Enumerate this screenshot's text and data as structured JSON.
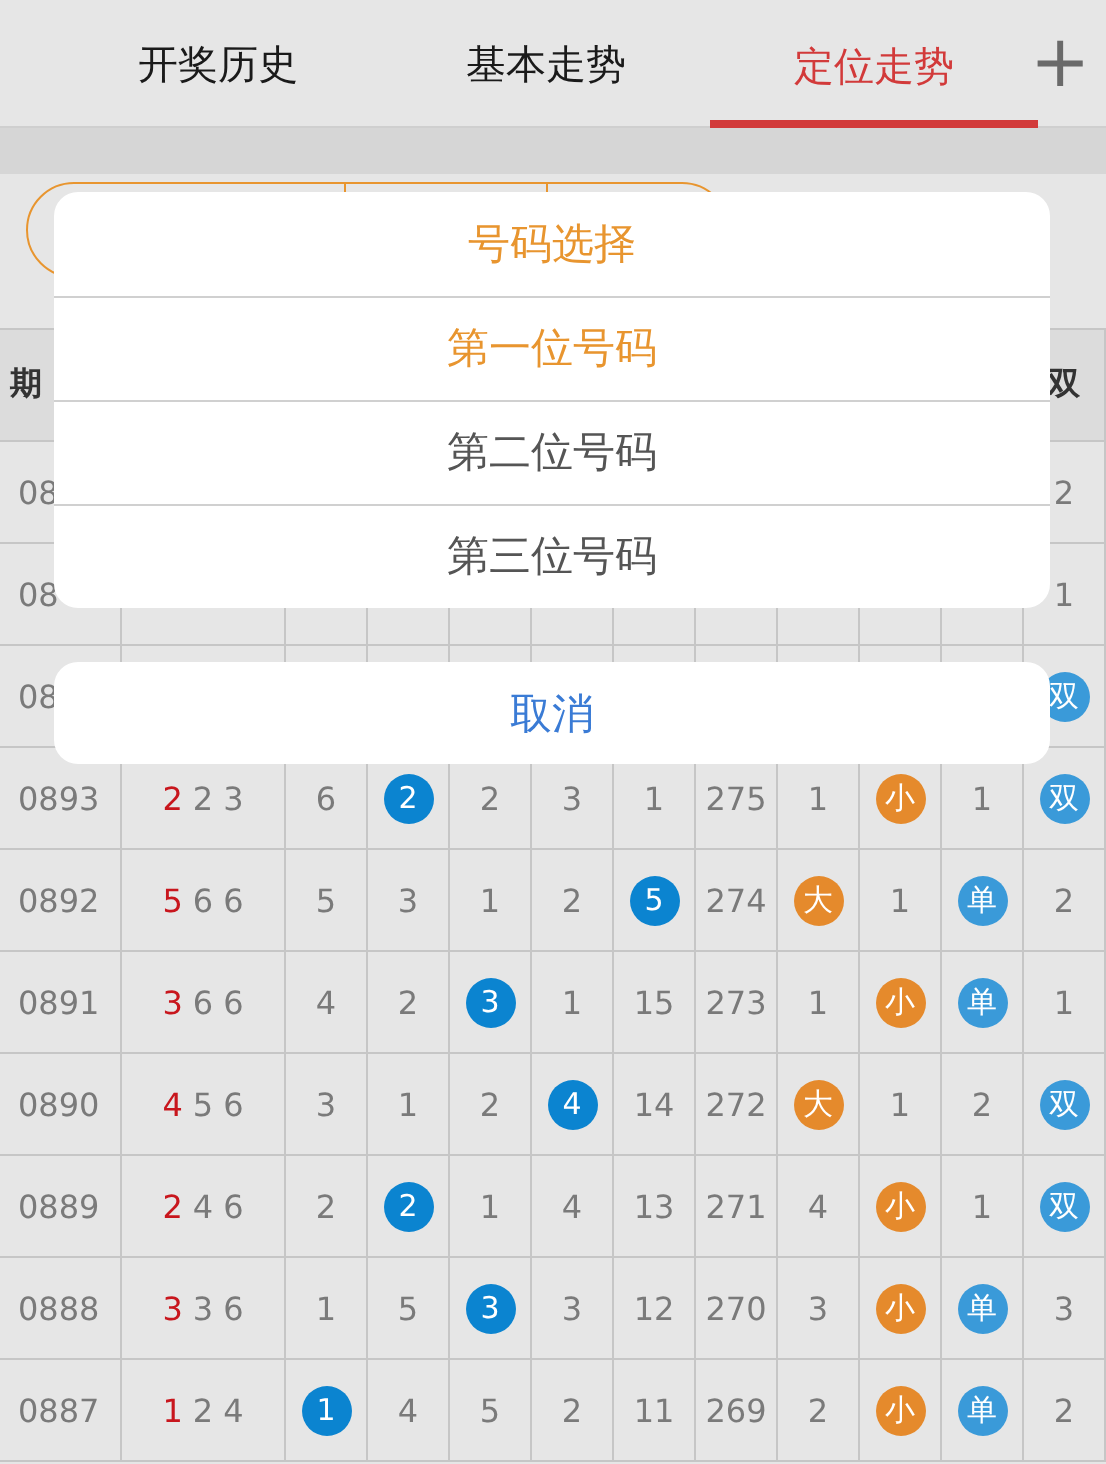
{
  "tabs": [
    {
      "label": "开奖历史",
      "selected": false
    },
    {
      "label": "基本走势",
      "selected": false
    },
    {
      "label": "定位走势",
      "selected": true
    }
  ],
  "add_button": {
    "label": "+"
  },
  "table": {
    "header": {
      "first": "期",
      "last": "双"
    },
    "hidden_rows": [
      {
        "issue": "08",
        "last": {
          "text": "2",
          "kind": "plain"
        }
      },
      {
        "issue": "08",
        "last": {
          "text": "1",
          "kind": "plain"
        }
      },
      {
        "issue": "08",
        "last": {
          "text": "双",
          "kind": "parity"
        }
      }
    ],
    "rows": [
      {
        "issue": "0893",
        "draw": [
          "2",
          "2",
          "3"
        ],
        "cells": [
          {
            "text": "6",
            "kind": "plain"
          },
          {
            "text": "2",
            "kind": "ball"
          },
          {
            "text": "2",
            "kind": "plain"
          },
          {
            "text": "3",
            "kind": "plain"
          },
          {
            "text": "1",
            "kind": "plain"
          },
          {
            "text": "275",
            "kind": "plain"
          },
          {
            "text": "1",
            "kind": "plain"
          },
          {
            "text": "小",
            "kind": "size"
          },
          {
            "text": "1",
            "kind": "plain"
          },
          {
            "text": "双",
            "kind": "parity"
          }
        ]
      },
      {
        "issue": "0892",
        "draw": [
          "5",
          "6",
          "6"
        ],
        "cells": [
          {
            "text": "5",
            "kind": "plain"
          },
          {
            "text": "3",
            "kind": "plain"
          },
          {
            "text": "1",
            "kind": "plain"
          },
          {
            "text": "2",
            "kind": "plain"
          },
          {
            "text": "5",
            "kind": "ball"
          },
          {
            "text": "274",
            "kind": "plain"
          },
          {
            "text": "大",
            "kind": "size"
          },
          {
            "text": "1",
            "kind": "plain"
          },
          {
            "text": "单",
            "kind": "parity"
          },
          {
            "text": "2",
            "kind": "plain"
          }
        ]
      },
      {
        "issue": "0891",
        "draw": [
          "3",
          "6",
          "6"
        ],
        "cells": [
          {
            "text": "4",
            "kind": "plain"
          },
          {
            "text": "2",
            "kind": "plain"
          },
          {
            "text": "3",
            "kind": "ball"
          },
          {
            "text": "1",
            "kind": "plain"
          },
          {
            "text": "15",
            "kind": "plain"
          },
          {
            "text": "273",
            "kind": "plain"
          },
          {
            "text": "1",
            "kind": "plain"
          },
          {
            "text": "小",
            "kind": "size"
          },
          {
            "text": "单",
            "kind": "parity"
          },
          {
            "text": "1",
            "kind": "plain"
          }
        ]
      },
      {
        "issue": "0890",
        "draw": [
          "4",
          "5",
          "6"
        ],
        "cells": [
          {
            "text": "3",
            "kind": "plain"
          },
          {
            "text": "1",
            "kind": "plain"
          },
          {
            "text": "2",
            "kind": "plain"
          },
          {
            "text": "4",
            "kind": "ball"
          },
          {
            "text": "14",
            "kind": "plain"
          },
          {
            "text": "272",
            "kind": "plain"
          },
          {
            "text": "大",
            "kind": "size"
          },
          {
            "text": "1",
            "kind": "plain"
          },
          {
            "text": "2",
            "kind": "plain"
          },
          {
            "text": "双",
            "kind": "parity"
          }
        ]
      },
      {
        "issue": "0889",
        "draw": [
          "2",
          "4",
          "6"
        ],
        "cells": [
          {
            "text": "2",
            "kind": "plain"
          },
          {
            "text": "2",
            "kind": "ball"
          },
          {
            "text": "1",
            "kind": "plain"
          },
          {
            "text": "4",
            "kind": "plain"
          },
          {
            "text": "13",
            "kind": "plain"
          },
          {
            "text": "271",
            "kind": "plain"
          },
          {
            "text": "4",
            "kind": "plain"
          },
          {
            "text": "小",
            "kind": "size"
          },
          {
            "text": "1",
            "kind": "plain"
          },
          {
            "text": "双",
            "kind": "parity"
          }
        ]
      },
      {
        "issue": "0888",
        "draw": [
          "3",
          "3",
          "6"
        ],
        "cells": [
          {
            "text": "1",
            "kind": "plain"
          },
          {
            "text": "5",
            "kind": "plain"
          },
          {
            "text": "3",
            "kind": "ball"
          },
          {
            "text": "3",
            "kind": "plain"
          },
          {
            "text": "12",
            "kind": "plain"
          },
          {
            "text": "270",
            "kind": "plain"
          },
          {
            "text": "3",
            "kind": "plain"
          },
          {
            "text": "小",
            "kind": "size"
          },
          {
            "text": "单",
            "kind": "parity"
          },
          {
            "text": "3",
            "kind": "plain"
          }
        ]
      },
      {
        "issue": "0887",
        "draw": [
          "1",
          "2",
          "4"
        ],
        "cells": [
          {
            "text": "1",
            "kind": "ball"
          },
          {
            "text": "4",
            "kind": "plain"
          },
          {
            "text": "5",
            "kind": "plain"
          },
          {
            "text": "2",
            "kind": "plain"
          },
          {
            "text": "11",
            "kind": "plain"
          },
          {
            "text": "269",
            "kind": "plain"
          },
          {
            "text": "2",
            "kind": "plain"
          },
          {
            "text": "小",
            "kind": "size"
          },
          {
            "text": "单",
            "kind": "parity"
          },
          {
            "text": "2",
            "kind": "plain"
          }
        ]
      }
    ]
  },
  "action_sheet": {
    "title": "号码选择",
    "options": [
      {
        "label": "第一位号码",
        "selected": true
      },
      {
        "label": "第二位号码",
        "selected": false
      },
      {
        "label": "第三位号码",
        "selected": false
      }
    ],
    "cancel": "取消"
  }
}
